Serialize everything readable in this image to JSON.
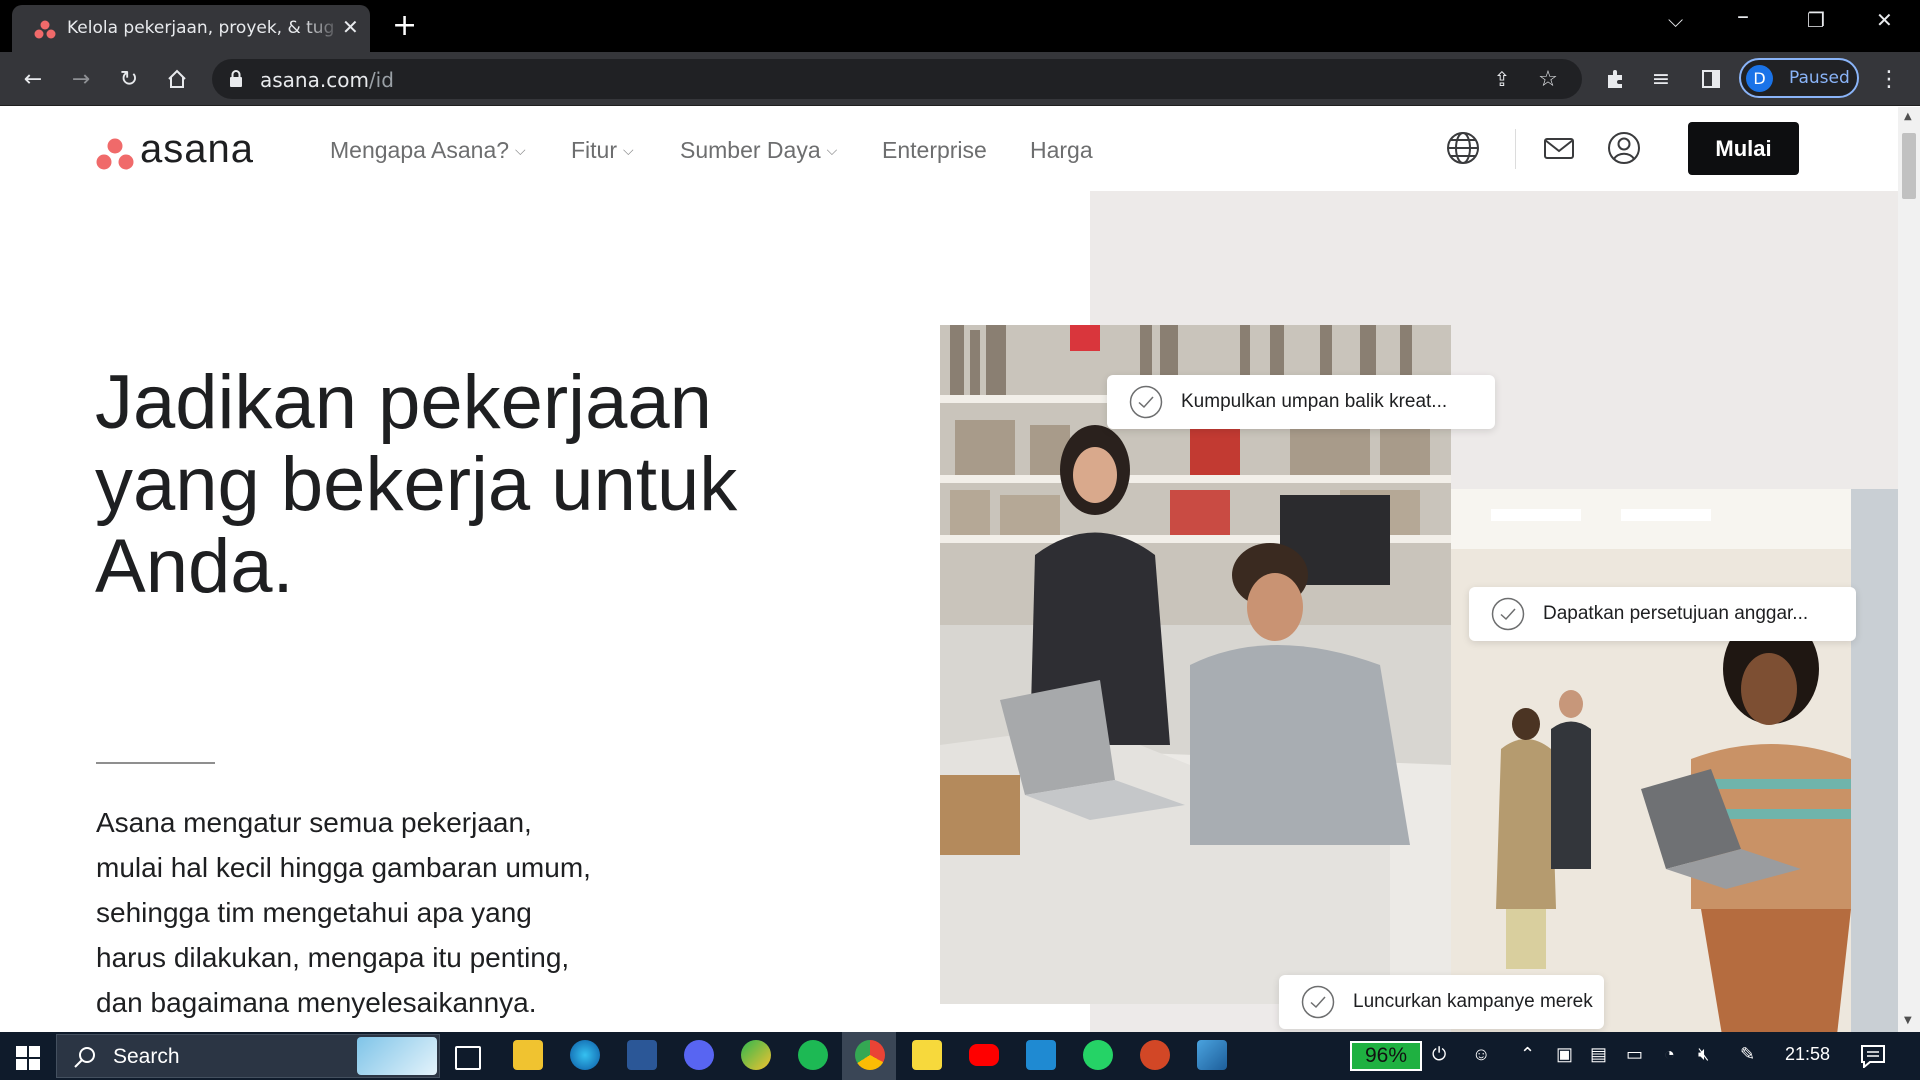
{
  "browser": {
    "tab_title": "Kelola pekerjaan, proyek, & tugas",
    "url_host": "asana.com",
    "url_path": "/id",
    "profile_initial": "D",
    "profile_status": "Paused"
  },
  "header": {
    "logo_text": "asana",
    "nav": [
      {
        "label": "Mengapa Asana?",
        "has_dropdown": true
      },
      {
        "label": "Fitur",
        "has_dropdown": true
      },
      {
        "label": "Sumber Daya",
        "has_dropdown": true
      },
      {
        "label": "Enterprise",
        "has_dropdown": false
      },
      {
        "label": "Harga",
        "has_dropdown": false
      }
    ],
    "cta_label": "Mulai"
  },
  "hero": {
    "title": "Jadikan pekerjaan yang bekerja untuk Anda.",
    "description": "Asana mengatur semua pekerjaan,\nmulai hal kecil hingga gambaran umum,\nsehingga tim mengetahui apa yang\nharus dilakukan, mengapa itu penting,\ndan bagaimana menyelesaikannya."
  },
  "tasks": [
    {
      "label": "Kumpulkan umpan balik kreat..."
    },
    {
      "label": "Dapatkan persetujuan anggar..."
    },
    {
      "label": "Luncurkan kampanye merek"
    }
  ],
  "taskbar": {
    "search_placeholder": "Search",
    "battery": "96%",
    "clock": "21:58"
  },
  "colors": {
    "brand_coral": "#f06a6a",
    "cta_bg": "#0d0e10",
    "panel_bg": "#edeae9",
    "battery_green": "#1fb141"
  }
}
